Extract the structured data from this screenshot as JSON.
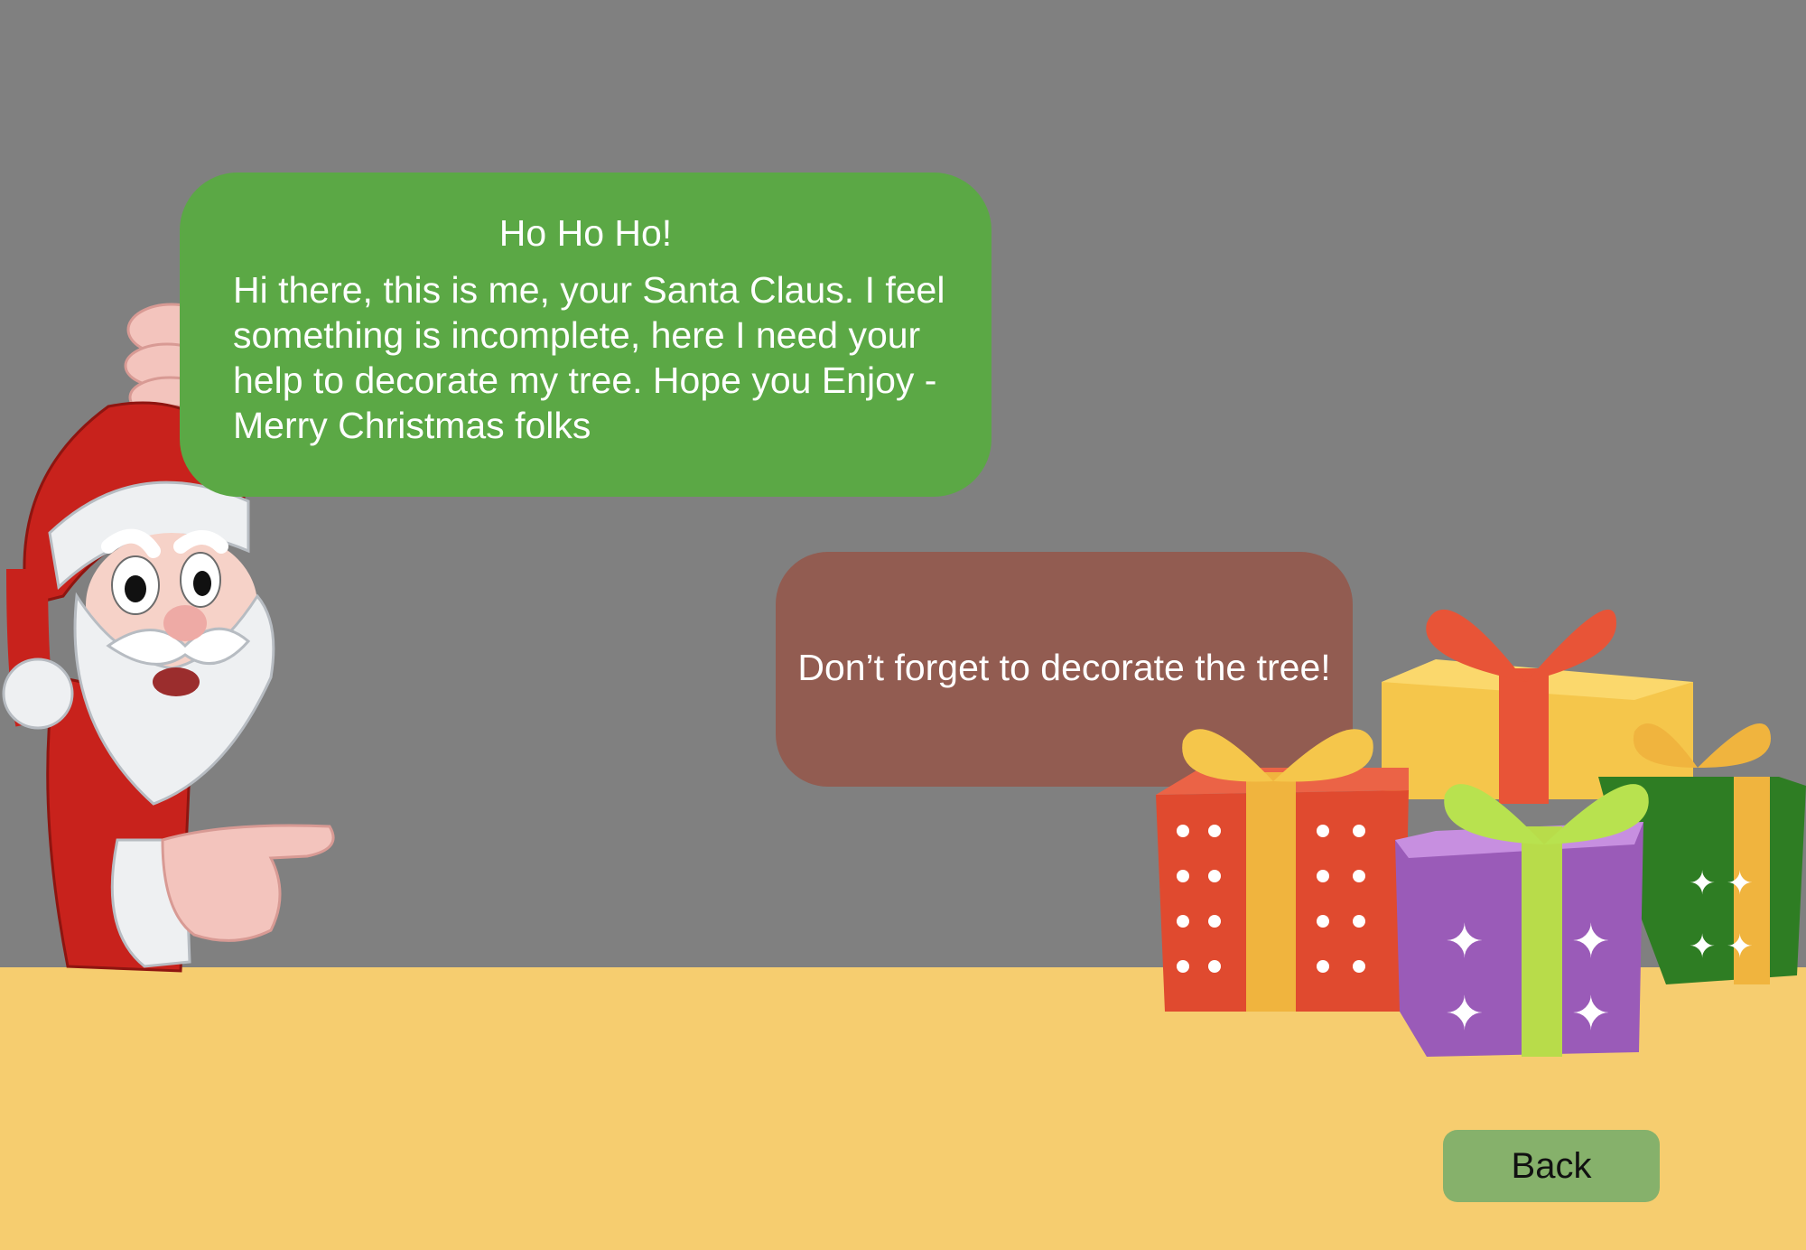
{
  "santa_bubble": {
    "title": "Ho Ho Ho!",
    "message": "Hi there, this is me, your Santa Claus. I feel something is incomplete, here I need your help to decorate my tree. Hope you Enjoy - Merry Christmas folks"
  },
  "reminder_bubble": {
    "message": "Don’t forget to decorate the tree!"
  },
  "navigation": {
    "back_label": "Back"
  },
  "illustrations": {
    "santa": "santa-claus-pointing",
    "gifts": "gift-boxes-pile"
  },
  "colors": {
    "wall": "#808080",
    "floor": "#f6cd6f",
    "speech_bubble": "#5ba845",
    "reminder_bubble": "#925c51",
    "back_button": "#86b16b"
  }
}
